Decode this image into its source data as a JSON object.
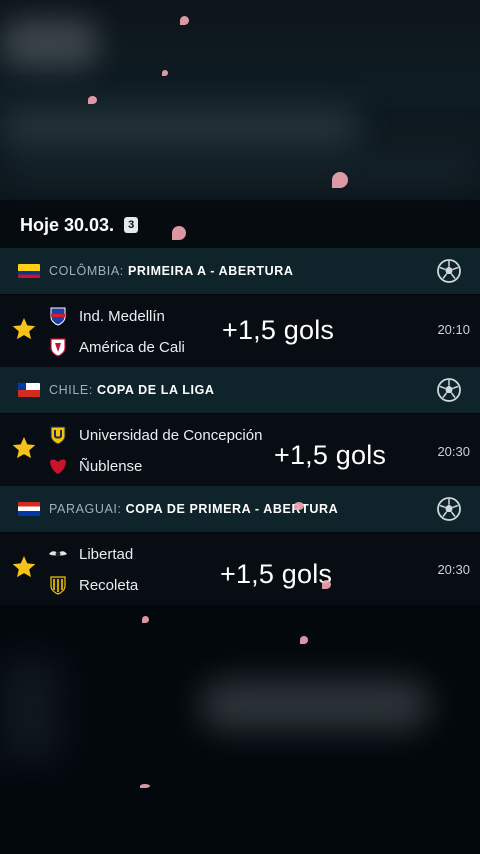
{
  "day": {
    "title": "Hoje 30.03.",
    "count": "3"
  },
  "leagues": [
    {
      "country": "COLÔMBIA:",
      "competition": "PRIMEIRA A - ABERTURA",
      "flag": "colombia-flag",
      "match": {
        "home": "Ind. Medellín",
        "away": "América de Cali",
        "time": "20:10",
        "overlay": "+1,5 gols"
      }
    },
    {
      "country": "CHILE:",
      "competition": "COPA DE LA LIGA",
      "flag": "chile-flag",
      "match": {
        "home": "Universidad de Concepción",
        "away": "Ñublense",
        "time": "20:30",
        "overlay": "+1,5 gols"
      }
    },
    {
      "country": "PARAGUAI:",
      "competition": "COPA DE PRIMERA - ABERTURA",
      "flag": "paraguay-flag",
      "match": {
        "home": "Libertad",
        "away": "Recoleta",
        "time": "20:30",
        "overlay": "+1,5 gols"
      }
    }
  ],
  "colors": {
    "accent_star": "#f7c21b",
    "league_bg": "#0f232a",
    "match_bg": "#070d12",
    "petal": "#f4a6b4"
  },
  "icons": [
    "star-icon",
    "soccer-ball-icon",
    "team-crest-icon"
  ]
}
